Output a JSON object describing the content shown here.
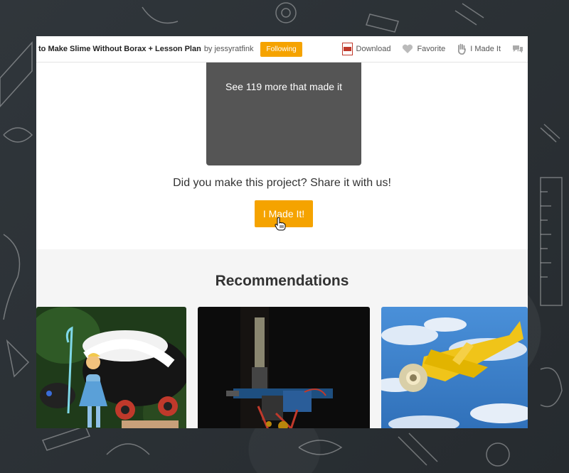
{
  "topbar": {
    "title": "to Make Slime Without Borax + Lesson Plan",
    "by": "by",
    "author": "jessyratfink",
    "follow_label": "Following",
    "actions": {
      "download": "Download",
      "favorite": "Favorite",
      "made_it": "I Made It"
    }
  },
  "made_it_section": {
    "more_text": "See 119 more that made it",
    "question": "Did you make this project? Share it with us!",
    "button_label": "I Made It!"
  },
  "recommendations": {
    "heading": "Recommendations"
  },
  "colors": {
    "accent": "#f5a300",
    "grey_box": "#555555",
    "section_bg": "#f5f5f5"
  }
}
